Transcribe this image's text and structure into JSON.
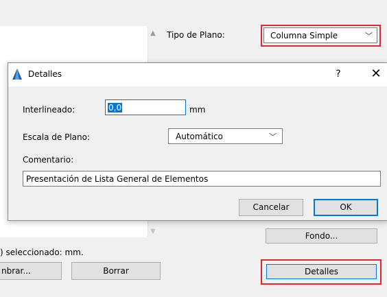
{
  "background": {
    "plan_type_label": "Tipo de Plano:",
    "plan_type_value": "Columna Simple",
    "fondo_button": "Fondo...",
    "status_text": ") seleccionado: mm.",
    "nombrar_button": "nbrar...",
    "borrar_button": "Borrar",
    "detalles_button": "Detalles"
  },
  "dialog": {
    "title": "Detalles",
    "help_glyph": "?",
    "close_glyph": "✕",
    "interlineado_label": "Interlineado:",
    "interlineado_value": "0,0",
    "interlineado_unit": "mm",
    "escala_label": "Escala de Plano:",
    "escala_value": "Automático",
    "comentario_label": "Comentario:",
    "comentario_value": "Presentación de Lista General de Elementos",
    "cancel_button": "Cancelar",
    "ok_button": "OK"
  },
  "colors": {
    "highlight": "#e3262d",
    "accent": "#0078d7"
  }
}
